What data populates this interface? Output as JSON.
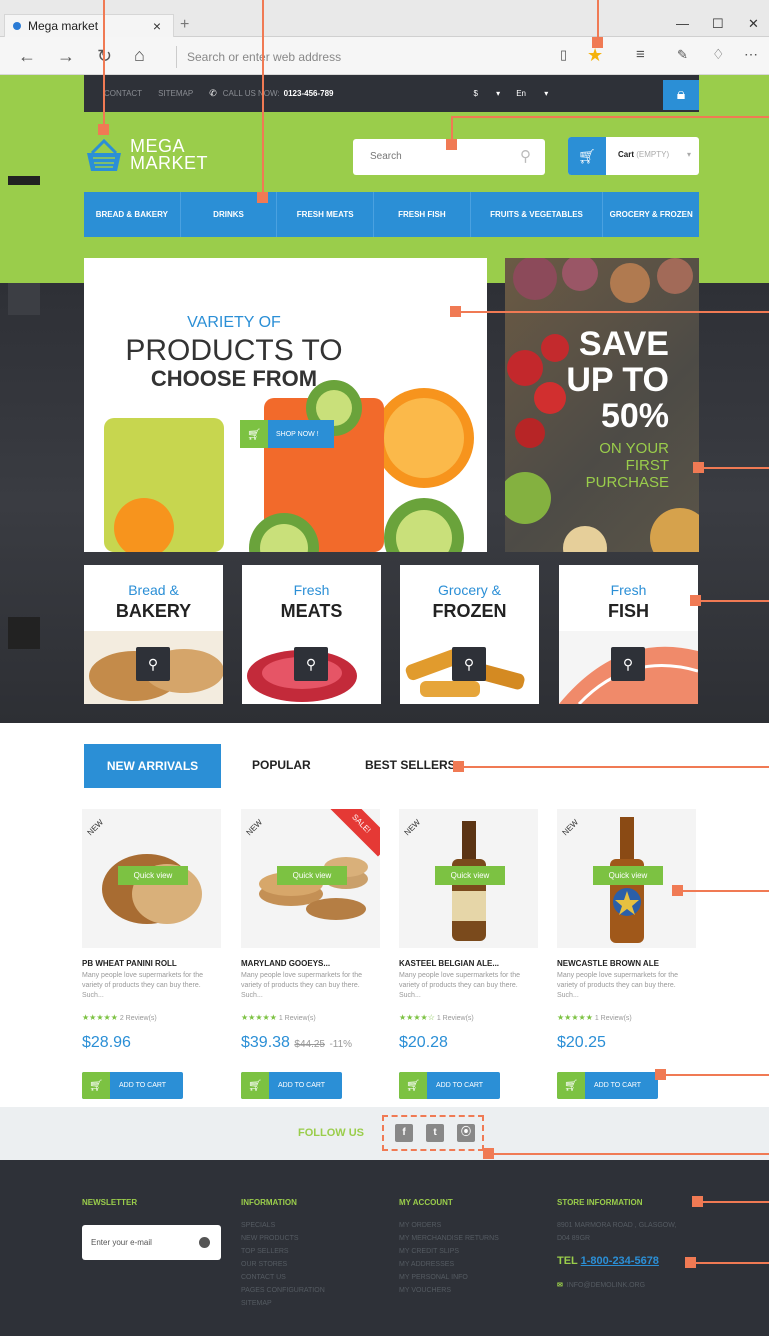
{
  "browser": {
    "tab_title": "Mega market",
    "address_placeholder": "Search or enter web address"
  },
  "topbar": {
    "contact": "CONTACT",
    "sitemap": "SITEMAP",
    "call_label": "CALL US NOW:",
    "phone": "0123-456-789",
    "currency": "$",
    "language": "En"
  },
  "header": {
    "logo_line1": "MEGA",
    "logo_line2": "MARKET",
    "search_placeholder": "Search",
    "cart_label": "Cart",
    "cart_status": "(EMPTY)"
  },
  "categories_nav": [
    "BREAD & BAKERY",
    "DRINKS",
    "FRESH MEATS",
    "FRESH FISH",
    "FRUITS & VEGETABLES",
    "GROCERY & FROZEN"
  ],
  "hero": {
    "line1": "VARIETY OF",
    "line2": "PRODUCTS TO",
    "line3": "CHOOSE FROM",
    "button": "SHOP NOW !"
  },
  "promo": {
    "line1": "SAVE",
    "line2": "UP TO",
    "line3": "50%",
    "line4": "ON YOUR",
    "line5": "FIRST",
    "line6": "PURCHASE"
  },
  "category_boxes": [
    {
      "top": "Bread &",
      "bottom": "BAKERY"
    },
    {
      "top": "Fresh",
      "bottom": "MEATS"
    },
    {
      "top": "Grocery &",
      "bottom": "FROZEN"
    },
    {
      "top": "Fresh",
      "bottom": "FISH"
    }
  ],
  "tabs": {
    "new": "NEW ARRIVALS",
    "popular": "POPULAR",
    "best": "BEST SELLERS"
  },
  "products": [
    {
      "badge": "NEW",
      "quick": "Quick view",
      "name": "PB WHEAT PANINI ROLL",
      "desc": "Many people love supermarkets for the variety of products they can buy there. Such...",
      "stars": "★★★★★",
      "reviews": "2 Review(s)",
      "price": "$28.96",
      "old": "",
      "discount": "",
      "cart": "ADD TO CART"
    },
    {
      "badge": "NEW",
      "sale": "SALE!",
      "quick": "Quick view",
      "name": "MARYLAND GOOEYS...",
      "desc": "Many people love supermarkets for the variety of products they can buy there. Such...",
      "stars": "★★★★★",
      "reviews": "1 Review(s)",
      "price": "$39.38",
      "old": "$44.25",
      "discount": "-11%",
      "cart": "ADD TO CART"
    },
    {
      "badge": "NEW",
      "quick": "Quick view",
      "name": "KASTEEL BELGIAN ALE...",
      "desc": "Many people love supermarkets for the variety of products they can buy there. Such...",
      "stars": "★★★★☆",
      "reviews": "1 Review(s)",
      "price": "$20.28",
      "old": "",
      "discount": "",
      "cart": "ADD TO CART"
    },
    {
      "badge": "NEW",
      "quick": "Quick view",
      "name": "NEWCASTLE BROWN ALE",
      "desc": "Many people love supermarkets for the variety of products they can buy there. Such...",
      "stars": "★★★★★",
      "reviews": "1 Review(s)",
      "price": "$20.25",
      "old": "",
      "discount": "",
      "cart": "ADD TO CART"
    }
  ],
  "follow": {
    "label": "FOLLOW US"
  },
  "footer": {
    "newsletter_title": "NEWSLETTER",
    "newsletter_placeholder": "Enter your e-mail",
    "info_title": "INFORMATION",
    "info_links": [
      "SPECIALS",
      "NEW PRODUCTS",
      "TOP SELLERS",
      "OUR STORES",
      "CONTACT US",
      "PAGES CONFIGURATION",
      "SITEMAP"
    ],
    "account_title": "MY ACCOUNT",
    "account_links": [
      "MY ORDERS",
      "MY MERCHANDISE RETURNS",
      "MY CREDIT SLIPS",
      "MY ADDRESSES",
      "MY PERSONAL INFO",
      "MY VOUCHERS"
    ],
    "store_title": "STORE INFORMATION",
    "address1": "8901 MARMORA ROAD , GLASGOW,",
    "address2": "D04 89GR",
    "tel_label": "TEL",
    "tel_number": "1-800-234-5678",
    "email": "INFO@DEMOLINK.ORG"
  },
  "colors": {
    "green": "#9acd4b",
    "blue": "#2b8fd6",
    "dark": "#2e3138",
    "annotation": "#f07a54"
  }
}
